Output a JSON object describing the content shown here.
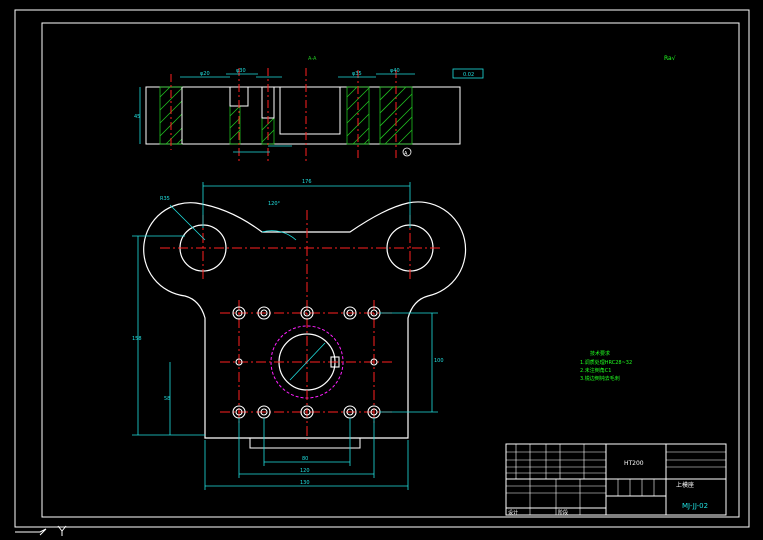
{
  "colors": {
    "background": "#000000",
    "outline": "#ffffff",
    "centerline": "#ff2020",
    "dimension": "#20e0e0",
    "hatch": "#20c020",
    "notes": "#20ff20",
    "circle": "#ff20ff",
    "title_text": "#ffffff"
  },
  "section_label": "A-A",
  "roughness_mark": "Ra√",
  "notes": {
    "title": "技术要求",
    "items": [
      "1.调质处理HRC28~32",
      "2.未注倒角C1",
      "3.锐边倒钝去毛刺"
    ]
  },
  "title_block": {
    "material": "HT200",
    "part_name": "上模座",
    "drawing_number": "MJ-JJ-02",
    "design_label": "设计",
    "stage_label": "阶段"
  },
  "dims": {
    "top_width": "100",
    "mid_width": "120",
    "bottom_width": "130",
    "overall_width": "176",
    "overall_height": "158",
    "hole_spacing": "80",
    "right_height": "100",
    "left_offset": "58",
    "radius_label": "R35",
    "angle_label": "120°",
    "thickness": "45",
    "section_dim_1": "φ20",
    "section_dim_2": "φ30",
    "section_dim_3": "φ35",
    "section_dim_4": "φ40",
    "section_tol": "0.02",
    "section_ref": "A"
  }
}
